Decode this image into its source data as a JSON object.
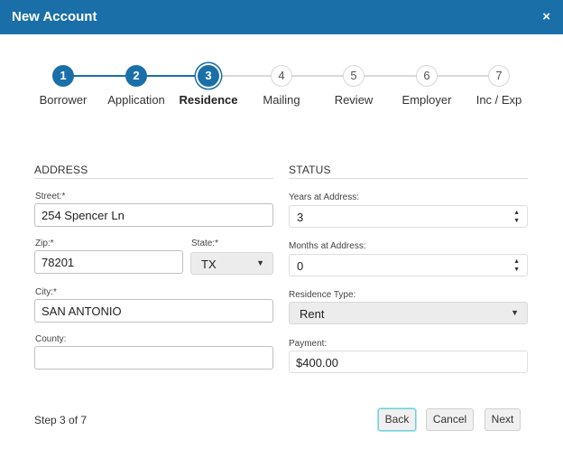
{
  "dialog": {
    "title": "New Account",
    "close_glyph": "×"
  },
  "stepper": {
    "current": 3,
    "steps": [
      {
        "number": "1",
        "label": "Borrower",
        "state": "done"
      },
      {
        "number": "2",
        "label": "Application",
        "state": "done"
      },
      {
        "number": "3",
        "label": "Residence",
        "state": "active"
      },
      {
        "number": "4",
        "label": "Mailing",
        "state": "todo"
      },
      {
        "number": "5",
        "label": "Review",
        "state": "todo"
      },
      {
        "number": "6",
        "label": "Employer",
        "state": "todo"
      },
      {
        "number": "7",
        "label": "Inc / Exp",
        "state": "todo"
      }
    ]
  },
  "address": {
    "section_title": "ADDRESS",
    "street_label": "Street:*",
    "street_value": "254 Spencer Ln",
    "zip_label": "Zip:*",
    "zip_value": "78201",
    "state_label": "State:*",
    "state_value": "TX",
    "city_label": "City:*",
    "city_value": "SAN ANTONIO",
    "county_label": "County:",
    "county_value": ""
  },
  "status": {
    "section_title": "STATUS",
    "years_label": "Years at Address:",
    "years_value": "3",
    "months_label": "Months at Address:",
    "months_value": "0",
    "residence_type_label": "Residence Type:",
    "residence_type_value": "Rent",
    "payment_label": "Payment:",
    "payment_value": "$400.00"
  },
  "footer": {
    "step_text": "Step 3 of 7",
    "back_label": "Back",
    "cancel_label": "Cancel",
    "next_label": "Next"
  },
  "icons": {
    "spin_up": "▲",
    "spin_down": "▼",
    "dropdown": "▼"
  },
  "colors": {
    "header": "#1a6fa8",
    "step_done": "#1a6fa8",
    "focus_ring": "#6fd0d8"
  }
}
